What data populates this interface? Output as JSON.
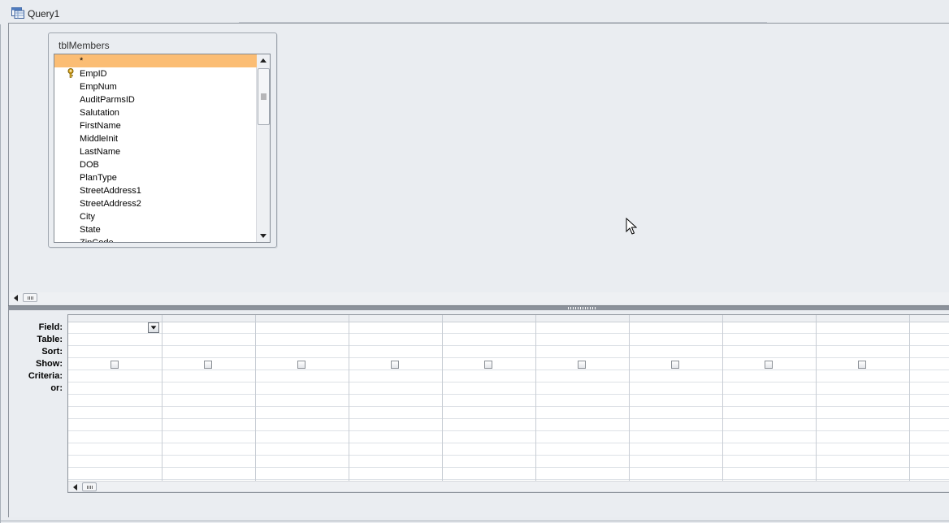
{
  "window": {
    "title": "Query1",
    "icon": "query-icon"
  },
  "table": {
    "name": "tblMembers",
    "fields": [
      "*",
      "EmpID",
      "EmpNum",
      "AuditParmsID",
      "Salutation",
      "FirstName",
      "MiddleInit",
      "LastName",
      "DOB",
      "PlanType",
      "StreetAddress1",
      "StreetAddress2",
      "City",
      "State",
      "ZipCode"
    ],
    "selected_index": 0,
    "primary_key_index": 1
  },
  "grid": {
    "row_labels": [
      "Field:",
      "Table:",
      "Sort:",
      "Show:",
      "Criteria:",
      "or:"
    ],
    "columns": [
      {
        "show": false
      },
      {
        "show": false
      },
      {
        "show": false
      },
      {
        "show": false
      },
      {
        "show": false
      },
      {
        "show": false
      },
      {
        "show": false
      },
      {
        "show": false
      },
      {
        "show": false
      }
    ]
  },
  "colors": {
    "selected_row": "#fbbd74",
    "background": "#e9ecf0"
  }
}
